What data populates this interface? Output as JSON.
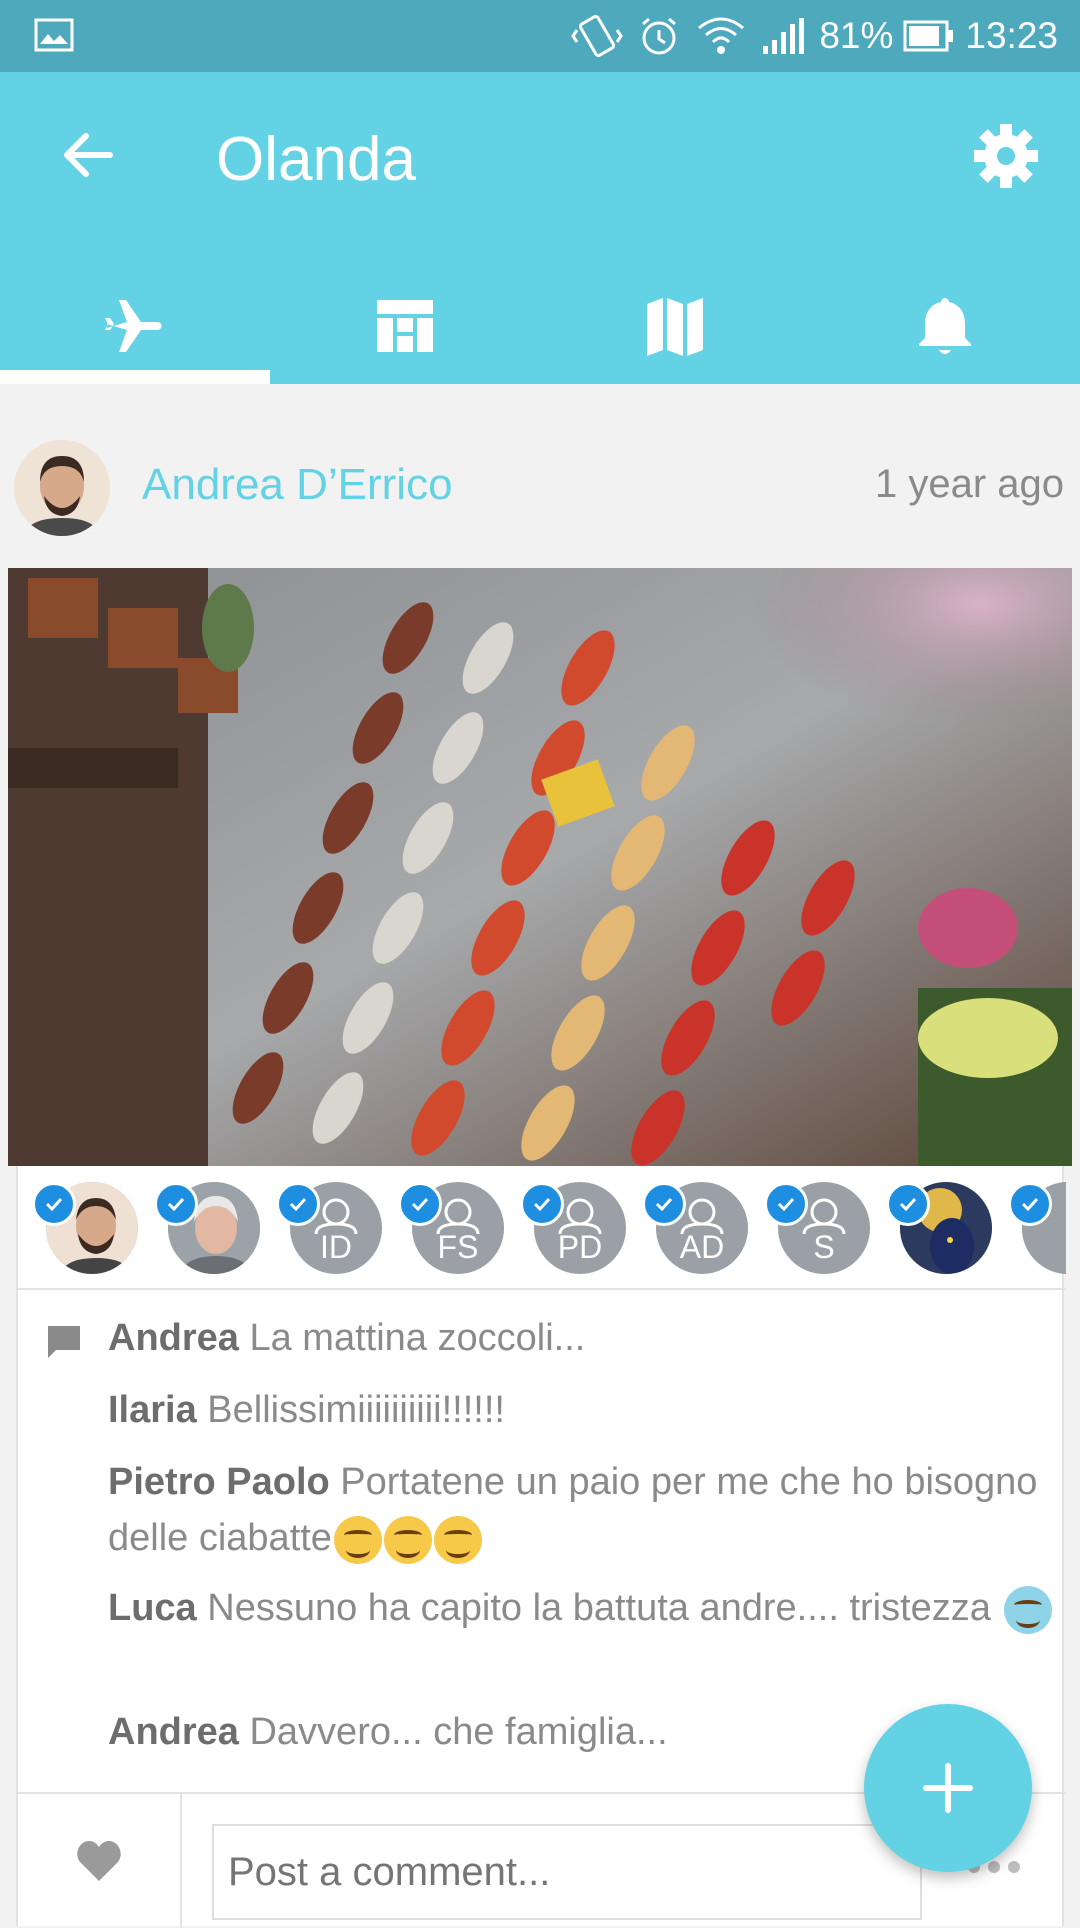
{
  "status_bar": {
    "battery": "81%",
    "time": "13:23",
    "icons": [
      "image-icon",
      "vibrate-icon",
      "alarm-icon",
      "wifi-icon",
      "signal-icon",
      "battery-icon"
    ]
  },
  "app_bar": {
    "title": "Olanda",
    "tabs": [
      {
        "icon": "plane-icon",
        "active": true
      },
      {
        "icon": "dashboard-icon",
        "active": false
      },
      {
        "icon": "map-icon",
        "active": false
      },
      {
        "icon": "bell-icon",
        "active": false
      }
    ]
  },
  "post": {
    "author": "Andrea D’Errico",
    "time": "1 year ago",
    "viewers": [
      {
        "initials": "",
        "kind": "photo"
      },
      {
        "initials": "",
        "kind": "photo"
      },
      {
        "initials": "ID",
        "kind": "placeholder"
      },
      {
        "initials": "FS",
        "kind": "placeholder"
      },
      {
        "initials": "PD",
        "kind": "placeholder"
      },
      {
        "initials": "AD",
        "kind": "placeholder"
      },
      {
        "initials": "S",
        "kind": "placeholder"
      },
      {
        "initials": "",
        "kind": "photo"
      }
    ],
    "comments": [
      {
        "name": "Andrea",
        "text": "La mattina zoccoli..."
      },
      {
        "name": "Ilaria",
        "text": "Bellissimiiiiiiiiii!!!!!!"
      },
      {
        "name": "Pietro Paolo",
        "text": "Portatene un paio per me che ho bisogno delle ciabatte"
      },
      {
        "name": "Luca",
        "text": "Nessuno ha capito la battuta andre.... tristezza"
      },
      {
        "name": "Andrea",
        "text": "Davvero... che famiglia..."
      }
    ],
    "comment_placeholder": "Post a comment..."
  },
  "colors": {
    "status_bar": "#4fa9bd",
    "app_bar": "#63d2e5",
    "accent": "#63d2e5",
    "check": "#1e8fe0"
  }
}
